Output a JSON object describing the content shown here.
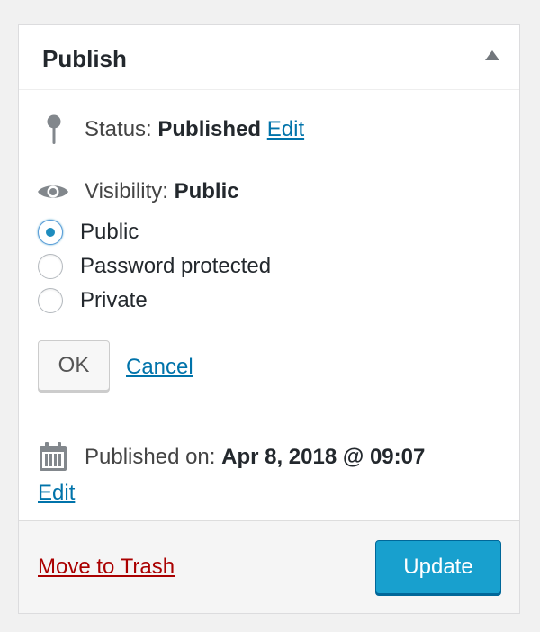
{
  "header": {
    "title": "Publish",
    "toggle_icon": "triangle-up-icon"
  },
  "status": {
    "label": "Status:",
    "value": "Published",
    "edit_label": "Edit",
    "icon": "pin-icon"
  },
  "visibility": {
    "label": "Visibility:",
    "value": "Public",
    "icon": "eye-icon",
    "options": [
      {
        "label": "Public",
        "checked": true
      },
      {
        "label": "Password protected",
        "checked": false
      },
      {
        "label": "Private",
        "checked": false
      }
    ],
    "ok_label": "OK",
    "cancel_label": "Cancel"
  },
  "published_on": {
    "label": "Published on:",
    "value": "Apr 8, 2018 @ 09:07",
    "edit_label": "Edit",
    "icon": "calendar-icon"
  },
  "footer": {
    "trash_label": "Move to Trash",
    "update_label": "Update"
  },
  "colors": {
    "accent": "#0073aa",
    "update_bg": "#18a0ce",
    "trash": "#aa0000"
  }
}
